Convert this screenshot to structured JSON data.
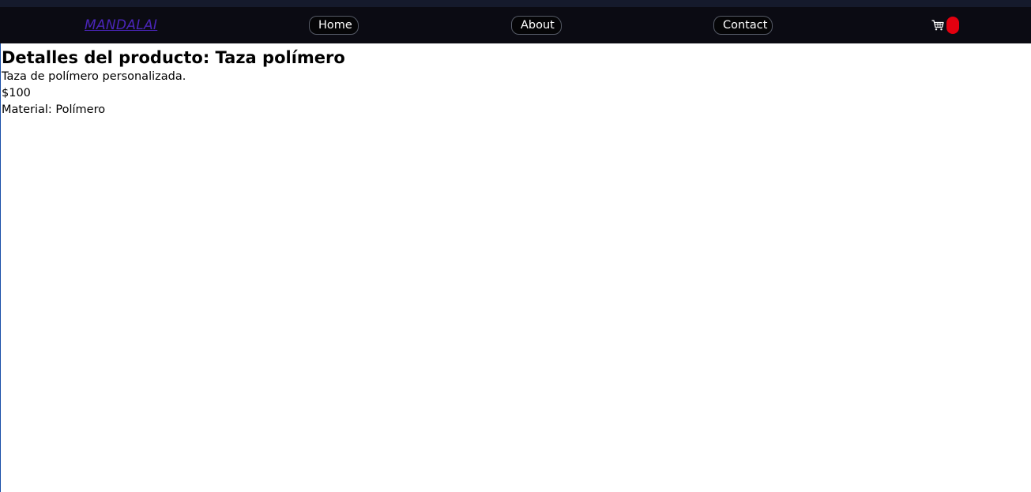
{
  "navbar": {
    "brand": "MANDALAI",
    "links": [
      {
        "label": "Home"
      },
      {
        "label": "About"
      },
      {
        "label": "Contact"
      }
    ],
    "cart": {
      "icon": "cart-icon",
      "badge_color": "#e3000f"
    },
    "background": "#0b0b13",
    "brand_color": "#4a25b8"
  },
  "product": {
    "heading": "Detalles del producto: Taza polímero",
    "description": "Taza de polímero personalizada.",
    "price": "$100",
    "material": "Material: Polímero"
  }
}
